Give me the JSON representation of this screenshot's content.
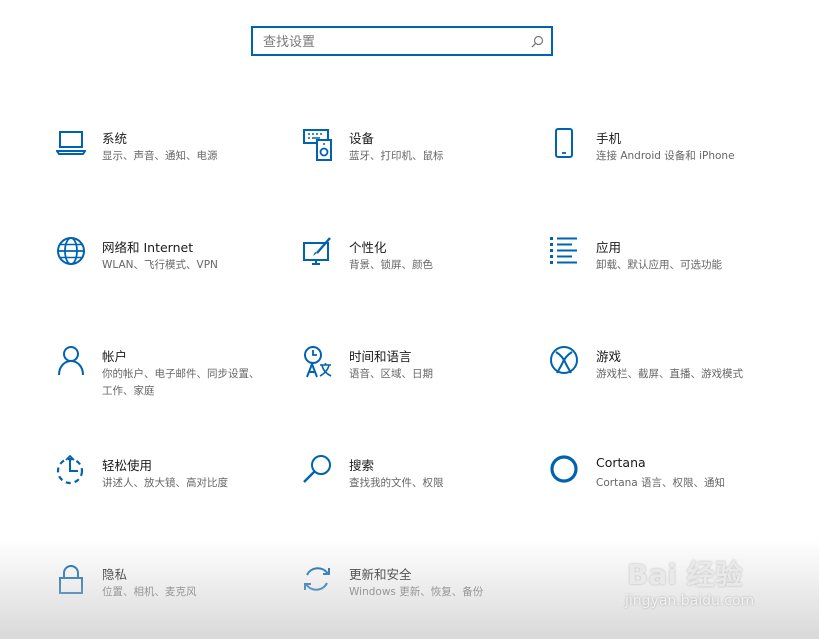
{
  "search": {
    "placeholder": "查找设置",
    "icon": "search-icon"
  },
  "accent_color": "#0063b1",
  "tiles": [
    {
      "icon": "laptop-icon",
      "title": "系统",
      "desc": "显示、声音、通知、电源"
    },
    {
      "icon": "keyboard-speaker-icon",
      "title": "设备",
      "desc": "蓝牙、打印机、鼠标"
    },
    {
      "icon": "phone-icon",
      "title": "手机",
      "desc": "连接 Android 设备和 iPhone"
    },
    {
      "icon": "globe-icon",
      "title": "网络和 Internet",
      "desc": "WLAN、飞行模式、VPN"
    },
    {
      "icon": "paint-brush-icon",
      "title": "个性化",
      "desc": "背景、锁屏、颜色"
    },
    {
      "icon": "apps-list-icon",
      "title": "应用",
      "desc": "卸载、默认应用、可选功能"
    },
    {
      "icon": "person-icon",
      "title": "帐户",
      "desc": "你的帐户、电子邮件、同步设置、工作、家庭"
    },
    {
      "icon": "time-language-icon",
      "title": "时间和语言",
      "desc": "语音、区域、日期"
    },
    {
      "icon": "xbox-icon",
      "title": "游戏",
      "desc": "游戏栏、截屏、直播、游戏模式"
    },
    {
      "icon": "ease-of-access-icon",
      "title": "轻松使用",
      "desc": "讲述人、放大镜、高对比度"
    },
    {
      "icon": "magnifier-icon",
      "title": "搜索",
      "desc": "查找我的文件、权限"
    },
    {
      "icon": "cortana-icon",
      "title": "Cortana",
      "desc": "Cortana 语言、权限、通知"
    },
    {
      "icon": "lock-icon",
      "title": "隐私",
      "desc": "位置、相机、麦克风"
    },
    {
      "icon": "update-sync-icon",
      "title": "更新和安全",
      "desc": "Windows 更新、恢复、备份"
    }
  ],
  "watermark": {
    "brand": "Bai 经验",
    "url": "jingyan.baidu.com"
  }
}
